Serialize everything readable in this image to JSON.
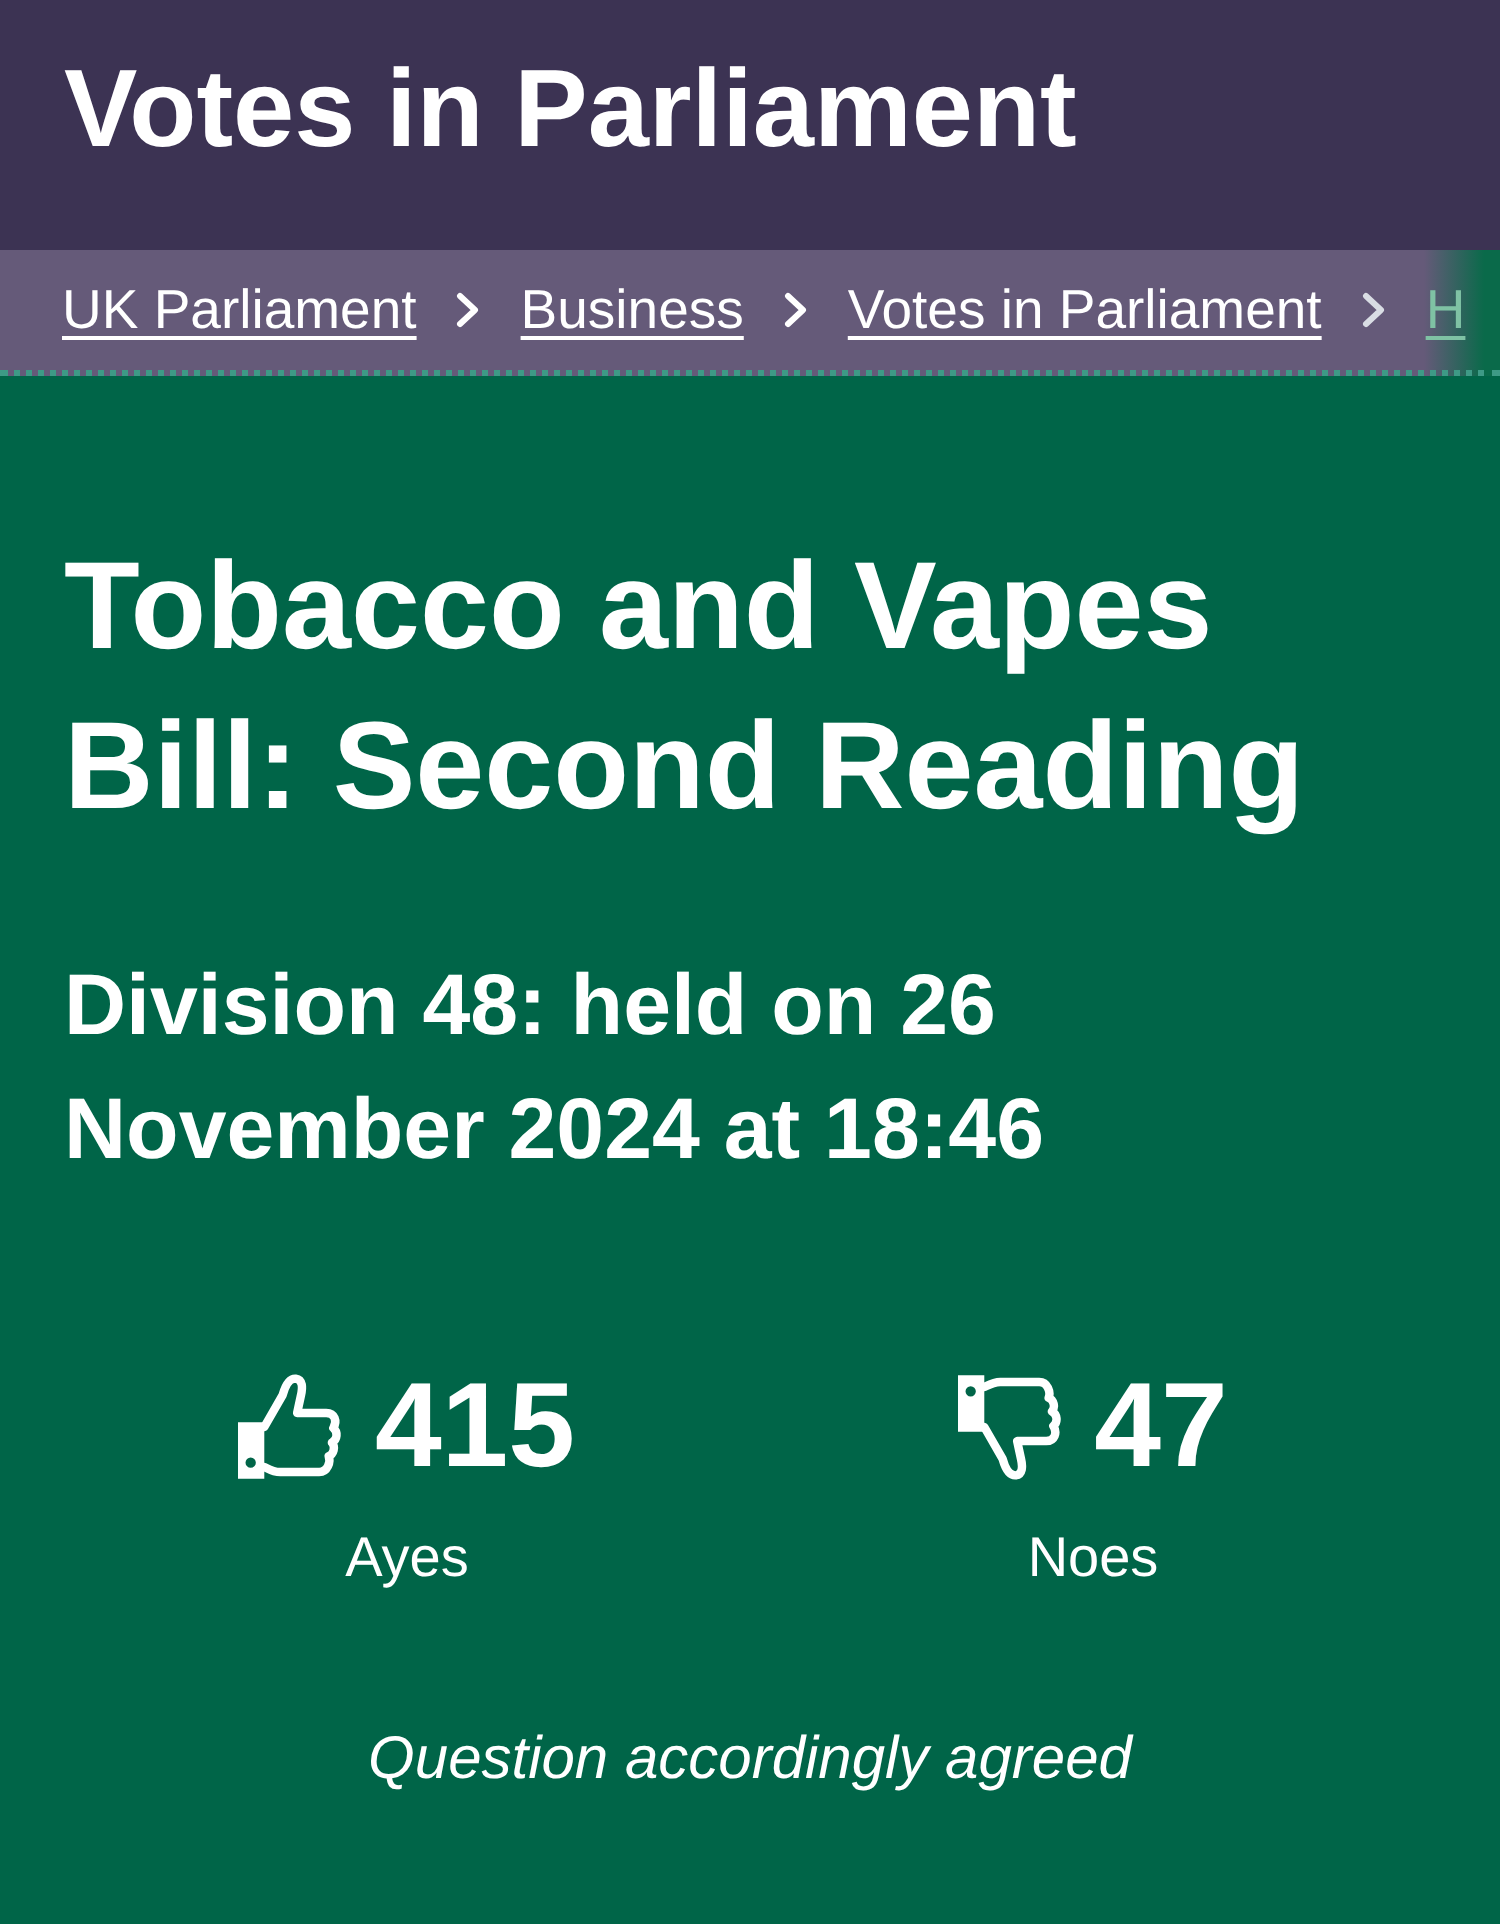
{
  "header": {
    "title": "Votes in Parliament"
  },
  "breadcrumbs": [
    {
      "label": "UK Parliament"
    },
    {
      "label": "Business"
    },
    {
      "label": "Votes in Parliament"
    },
    {
      "label": "H"
    }
  ],
  "division": {
    "title": "Tobacco and Vapes Bill: Second Reading",
    "subtitle": "Division 48: held on 26 November 2024 at 18:46"
  },
  "votes": [
    {
      "kind": "ayes",
      "count": "415",
      "label": "Ayes"
    },
    {
      "kind": "noes",
      "count": "47",
      "label": "Noes"
    }
  ],
  "result": "Question accordingly agreed"
}
